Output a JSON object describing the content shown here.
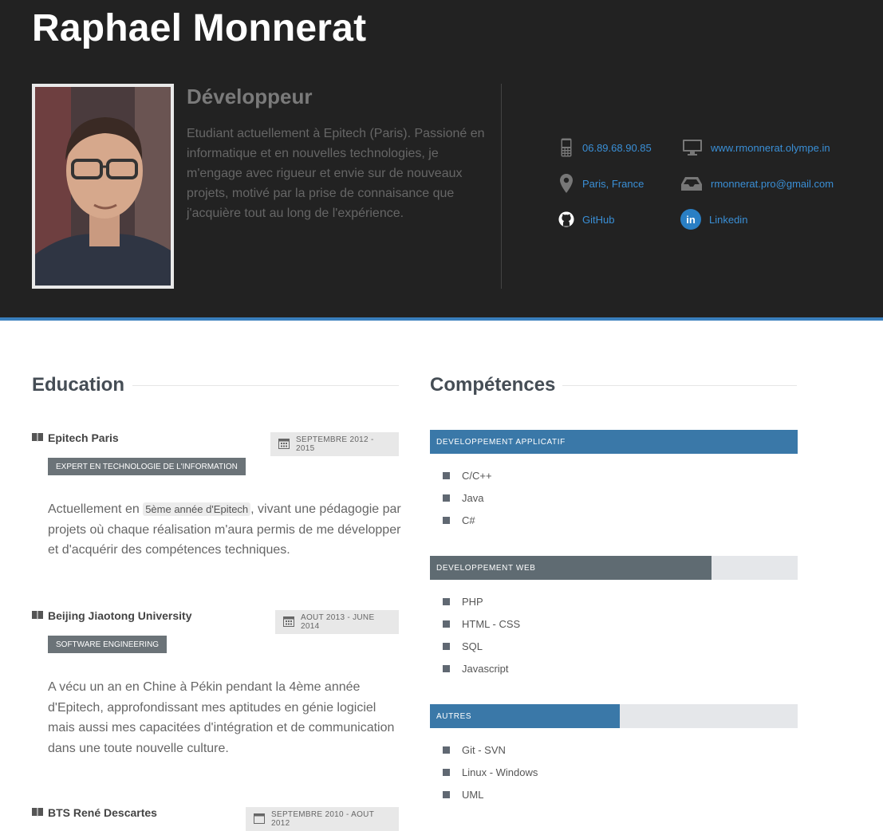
{
  "profile": {
    "name": "Raphael Monnerat",
    "role": "Développeur",
    "description": "Etudiant actuellement à Epitech (Paris). Passioné en informatique et en nouvelles technologies, je m'engage avec rigueur et envie sur de nouveaux projets, motivé par la prise de connaisance que j'acquière tout au long de l'expérience."
  },
  "contacts": {
    "phone": "06.89.68.90.85",
    "website": "www.rmonnerat.olympe.in",
    "location": "Paris, France",
    "email": "rmonnerat.pro@gmail.com",
    "github": "GitHub",
    "linkedin": "Linkedin"
  },
  "education": {
    "title": "Education",
    "items": [
      {
        "school": "Epitech Paris",
        "date": "SEPTEMBRE 2012 - 2015",
        "tag": "EXPERT EN TECHNOLOGIE DE L'INFORMATION",
        "text_before": "Actuellement en ",
        "highlight": "5ème année d'Epitech",
        "text_after": ", vivant une pédagogie par projets où chaque réalisation m'aura permis de me développer et d'acquérir des compétences techniques."
      },
      {
        "school": "Beijing Jiaotong University",
        "date": "AOUT 2013 - JUNE 2014",
        "tag": "SOFTWARE ENGINEERING",
        "text": "A vécu un an en Chine à Pékin pendant la 4ème année d'Epitech, approfondissant mes aptitudes en génie logiciel mais aussi mes capacitées d'intégration et de communication dans une toute nouvelle culture."
      },
      {
        "school": "BTS René Descartes",
        "date": "SEPTEMBRE 2010 - AOUT 2012"
      }
    ]
  },
  "skills": {
    "title": "Compétences",
    "groups": [
      {
        "label": "DEVELOPPEMENT APPLICATIF",
        "level": 1.0,
        "color": "#3a78a8",
        "items": [
          "C/C++",
          "Java",
          "C#"
        ]
      },
      {
        "label": "DEVELOPPEMENT WEB",
        "level": 0.766,
        "color": "#5f6b72",
        "items": [
          "PHP",
          "HTML - CSS",
          "SQL",
          "Javascript"
        ]
      },
      {
        "label": "AUTRES",
        "level": 0.516,
        "color": "#3a78a8",
        "items": [
          "Git - SVN",
          "Linux - Windows",
          "UML"
        ]
      }
    ]
  },
  "colors": {
    "header_bg": "#222222",
    "accent": "#3a7fbd",
    "link": "#3a8fd6"
  },
  "icons": [
    "mobile-phone-icon",
    "monitor-icon",
    "map-pin-icon",
    "inbox-icon",
    "github-icon",
    "linkedin-icon",
    "book-icon",
    "calendar-icon"
  ]
}
